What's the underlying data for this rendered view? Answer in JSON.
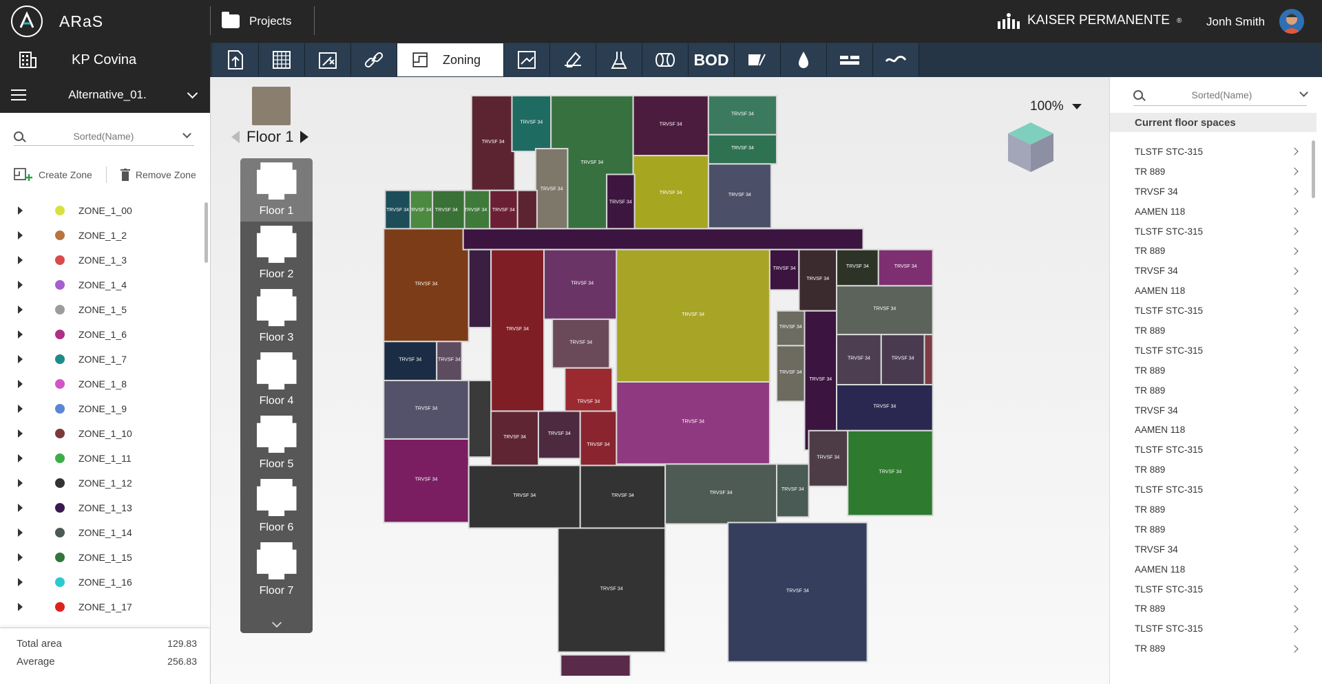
{
  "app": {
    "name": "ARaS",
    "projects_label": "Projects",
    "brand": "KAISER PERMANENTE",
    "brand_mark": "®",
    "user": "Jonh Smith"
  },
  "project": {
    "name": "KP Covina"
  },
  "toolbar": {
    "active_label": "Zoning",
    "bod_label": "BOD",
    "tools": [
      "import-icon",
      "grid-icon",
      "room-edit-icon",
      "link-icon",
      "zoning-icon",
      "plan-layers-icon",
      "annotate-icon",
      "lab-flask-icon",
      "pipe-icon",
      "bod",
      "material-icon",
      "water-drop-icon",
      "wall-type-icon",
      "wave-icon"
    ]
  },
  "left": {
    "alternative": "Alternative_01.",
    "search_placeholder": "Sorted(Name)",
    "create_zone": "Create Zone",
    "remove_zone": "Remove Zone",
    "zones": [
      {
        "name": "ZONE_1_00",
        "color": "#d8e03c"
      },
      {
        "name": "ZONE_1_2",
        "color": "#b8743f"
      },
      {
        "name": "ZONE_1_3",
        "color": "#d94a4a"
      },
      {
        "name": "ZONE_1_4",
        "color": "#a55fcf"
      },
      {
        "name": "ZONE_1_5",
        "color": "#9c9c9c"
      },
      {
        "name": "ZONE_1_6",
        "color": "#b22e86"
      },
      {
        "name": "ZONE_1_7",
        "color": "#1e8b8b"
      },
      {
        "name": "ZONE_1_8",
        "color": "#d255c7"
      },
      {
        "name": "ZONE_1_9",
        "color": "#5b85d8"
      },
      {
        "name": "ZONE_1_10",
        "color": "#7b3a3a"
      },
      {
        "name": "ZONE_1_11",
        "color": "#3cae49"
      },
      {
        "name": "ZONE_1_12",
        "color": "#333333"
      },
      {
        "name": "ZONE_1_13",
        "color": "#3a1a4e"
      },
      {
        "name": "ZONE_1_14",
        "color": "#4a5a55"
      },
      {
        "name": "ZONE_1_15",
        "color": "#35753a"
      },
      {
        "name": "ZONE_1_16",
        "color": "#2cc9cf"
      },
      {
        "name": "ZONE_1_17",
        "color": "#e0201d"
      }
    ],
    "total_area_label": "Total area",
    "total_area": "129.83",
    "average_label": "Average",
    "average": "256.83"
  },
  "canvas": {
    "floor_label": "Floor 1",
    "zoom": "100%",
    "floors": [
      "Floor 1",
      "Floor 2",
      "Floor 3",
      "Floor 4",
      "Floor 5",
      "Floor 6",
      "Floor 7"
    ]
  },
  "right": {
    "search_placeholder": "Sorted(Name)",
    "header": "Current floor spaces",
    "spaces": [
      "TLSTF STC-315",
      "TR 889",
      "TRVSF 34",
      "AAMEN 118",
      "TLSTF STC-315",
      "TR 889",
      "TRVSF 34",
      "AAMEN 118",
      "TLSTF STC-315",
      "TR 889",
      "TLSTF STC-315",
      "TR 889",
      "TR 889",
      "TRVSF 34",
      "AAMEN 118",
      "TLSTF STC-315",
      "TR 889",
      "TLSTF STC-315",
      "TR 889",
      "TR 889",
      "TRVSF 34",
      "AAMEN 118",
      "TLSTF STC-315",
      "TR 889",
      "TLSTF STC-315",
      "TR 889"
    ]
  },
  "room_label": "TRVSF 34"
}
